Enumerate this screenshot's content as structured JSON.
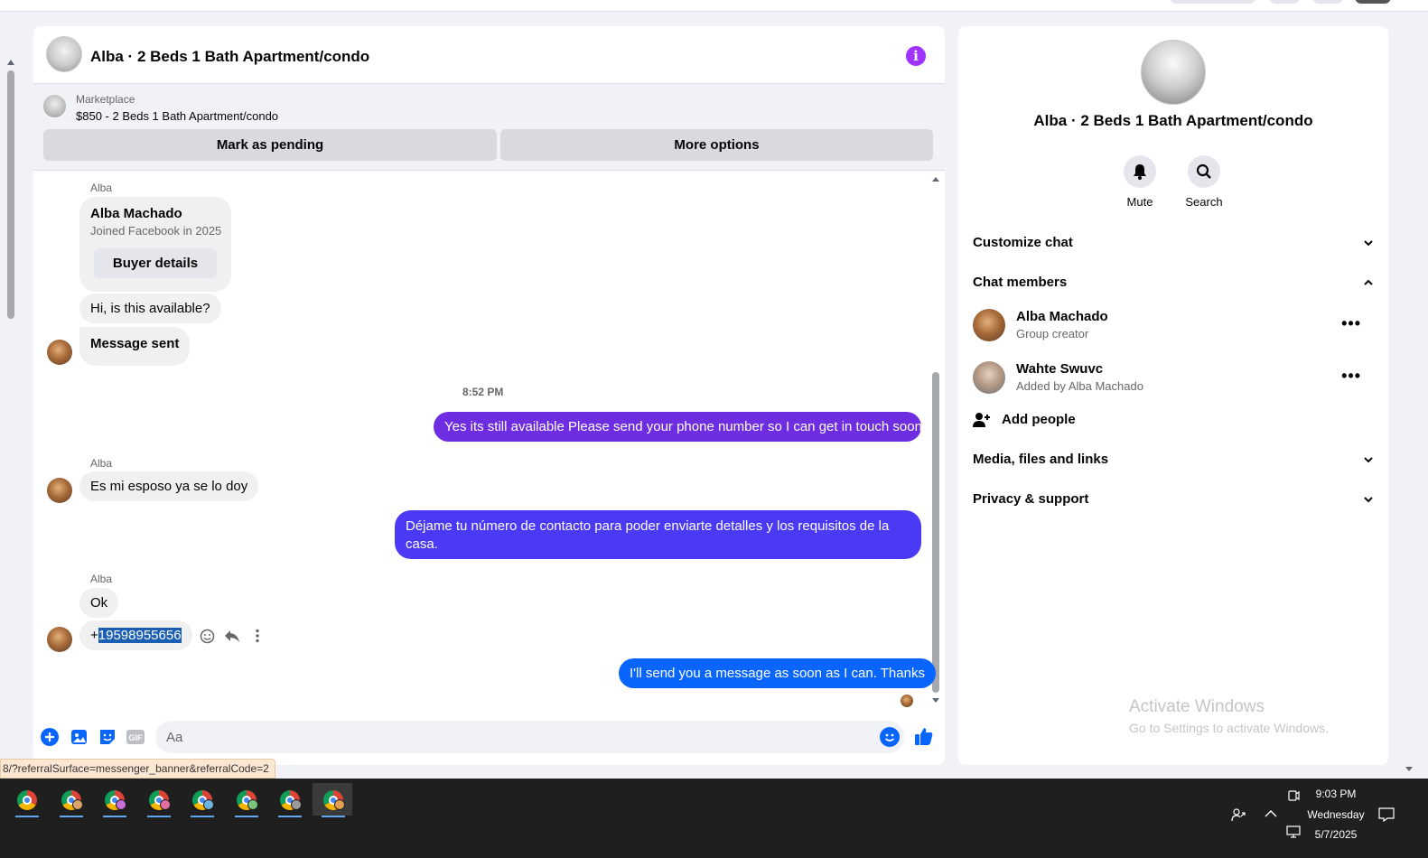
{
  "header": {
    "title": "Alba · 2 Beds 1 Bath Apartment/condo"
  },
  "marketplace": {
    "label": "Marketplace",
    "listing": "$850 - 2 Beds 1 Bath Apartment/condo",
    "mark_pending": "Mark as pending",
    "more_options": "More options"
  },
  "messages": {
    "sender_1": "Alba",
    "card_name": "Alba Machado",
    "card_sub": "Joined Facebook in 2025",
    "buyer_details": "Buyer details",
    "m1": "Hi, is this available?",
    "m2": "Message sent",
    "time": "8:52 PM",
    "out1": "Yes its still available Please send your phone number so I can get in touch soon",
    "sender_2": "Alba",
    "m3": "Es  mi esposo  ya se lo doy",
    "out2": "Déjame tu número de contacto para poder enviarte detalles y los requisitos de la casa.",
    "sender_3": "Alba",
    "m4": "Ok",
    "m5_prefix": "+",
    "m5_number": "19598955656",
    "out3": "I'll send you a message as soon as I can. Thanks",
    "out_colors": [
      "#6e2de0",
      "#4a3af5",
      "#0866ff"
    ]
  },
  "composer": {
    "placeholder": "Aa"
  },
  "sidebar": {
    "title": "Alba · 2 Beds 1 Bath Apartment/condo",
    "mute": "Mute",
    "search": "Search",
    "customize": "Customize chat",
    "members_heading": "Chat members",
    "members": [
      {
        "name": "Alba Machado",
        "sub": "Group creator"
      },
      {
        "name": "Wahte Swuvc",
        "sub": "Added by Alba Machado"
      }
    ],
    "add_people": "Add people",
    "media": "Media, files and links",
    "privacy": "Privacy & support"
  },
  "watermark": {
    "line1": "Activate Windows",
    "line2": "Go to Settings to activate Windows."
  },
  "status_url": "8/?referralSurface=messenger_banner&referralCode=2",
  "taskbar": {
    "time": "9:03 PM",
    "day": "Wednesday",
    "date": "5/7/2025"
  }
}
